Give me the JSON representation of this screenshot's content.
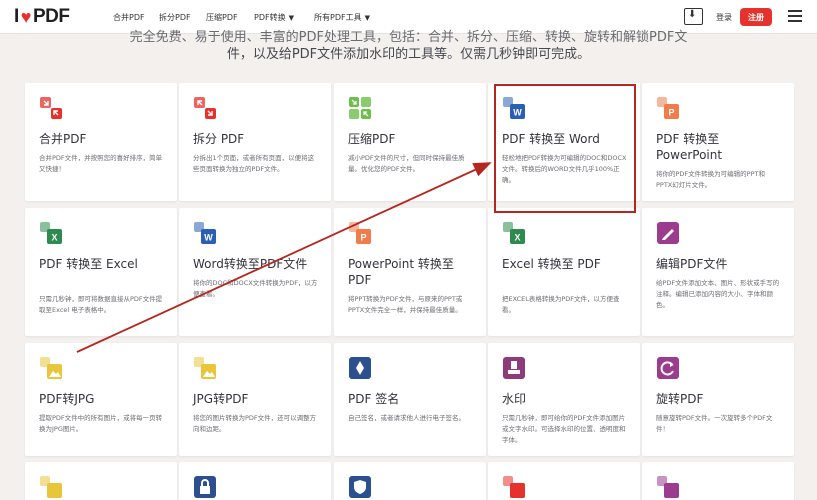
{
  "header": {
    "logo_text_left": "I",
    "logo_text_right": "PDF",
    "nav": [
      {
        "label": "合并PDF"
      },
      {
        "label": "拆分PDF"
      },
      {
        "label": "压缩PDF"
      },
      {
        "label": "PDF转换",
        "has_caret": true
      },
      {
        "label": "所有PDF工具",
        "has_caret": true
      }
    ],
    "login": "登录",
    "signup": "注册"
  },
  "intro": {
    "line1": "完全免费、易于使用、丰富的PDF处理工具，包括：合并、拆分、压缩、转换、旋转和解锁PDF文",
    "line2": "件，以及给PDF文件添加水印的工具等。仅需几秒钟即可完成。"
  },
  "tools": [
    {
      "title": "合并PDF",
      "desc": "合并PDF文件，并按照您的喜好排序，简单又快捷！",
      "icon": "merge-icon",
      "color": "#e5322d"
    },
    {
      "title": "拆分 PDF",
      "desc": "分拆出1个页面，或者所有页面，以便将这些页面转换为独立的PDF文件。",
      "icon": "split-icon",
      "color": "#e5322d"
    },
    {
      "title": "压缩PDF",
      "desc": "减小PDF文件的尺寸，但同时保持最佳质量。优化您的PDF文件。",
      "icon": "compress-icon",
      "color": "#6cc04a"
    },
    {
      "title": "PDF 转换至 Word",
      "desc": "轻松地把PDF转换为可编辑的DOC和DOCX文件。转换后的WORD文件几乎100%正确。",
      "icon": "word-icon",
      "color": "#2b5fb4"
    },
    {
      "title": "PDF 转换至 PowerPoint",
      "desc": "将你的PDF文件转换为可编辑的PPT和PPTX幻灯片文件。",
      "icon": "powerpoint-icon",
      "color": "#f07c4b"
    },
    {
      "title": "PDF 转换至 Excel",
      "desc": "只需几秒钟，即可将数据直接从PDF文件提取至Excel 电子表格中。",
      "icon": "excel-icon",
      "color": "#2e8b4e"
    },
    {
      "title": "Word转换至PDF文件",
      "desc": "将你的DOC和DOCX文件转换为PDF，以方便查看。",
      "icon": "word-to-pdf-icon",
      "color": "#2b5fb4"
    },
    {
      "title": "PowerPoint 转换至 PDF",
      "desc": "将PPT转换为PDF文件，与原来的PPT或PPTX文件完全一样，并保持最佳质量。",
      "icon": "powerpoint-to-pdf-icon",
      "color": "#f07c4b"
    },
    {
      "title": "Excel 转换至 PDF",
      "desc": "把EXCEL表格转换为PDF文件，以方便查看。",
      "icon": "excel-to-pdf-icon",
      "color": "#2e8b4e"
    },
    {
      "title": "编辑PDF文件",
      "desc": "给PDF文件添加文本、图片、形状或手写的注释。编辑已添加内容的大小、字体和颜色。",
      "icon": "edit-pdf-icon",
      "color": "#9b3c8e"
    },
    {
      "title": "PDF转JPG",
      "desc": "提取PDF文件中的所有图片，或将每一页转换为JPG图片。",
      "icon": "pdf-to-jpg-icon",
      "color": "#e8c53a"
    },
    {
      "title": "JPG转PDF",
      "desc": "将您的图片转换为PDF文件，还可以调整方向和边距。",
      "icon": "jpg-to-pdf-icon",
      "color": "#e8c53a"
    },
    {
      "title": "PDF 签名",
      "desc": "自己签名，或者请求他人进行电子签名。",
      "icon": "sign-icon",
      "color": "#2b4f8f"
    },
    {
      "title": "水印",
      "desc": "只需几秒钟，即可给你的PDF文件添加图片或文字水印。可选择水印的位置、透明度和字体。",
      "icon": "watermark-icon",
      "color": "#8e3a7b"
    },
    {
      "title": "旋转PDF",
      "desc": "随意旋转PDF文件。一次旋转多个PDF文件！",
      "icon": "rotate-icon",
      "color": "#9b3c8e"
    },
    {
      "title": "",
      "desc": "",
      "icon": "html-icon",
      "color": "#e8c53a"
    },
    {
      "title": "",
      "desc": "",
      "icon": "lock-icon",
      "color": "#2b4f8f"
    },
    {
      "title": "",
      "desc": "",
      "icon": "shield-icon",
      "color": "#2b4f8f"
    },
    {
      "title": "",
      "desc": "",
      "icon": "organize-icon",
      "color": "#e5322d"
    },
    {
      "title": "",
      "desc": "",
      "icon": "page-number-icon",
      "color": "#9b3c8e"
    }
  ]
}
